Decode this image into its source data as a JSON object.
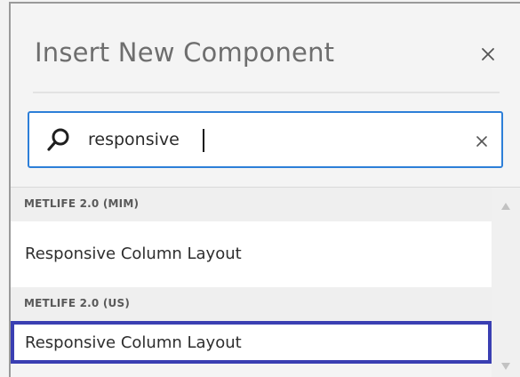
{
  "dialog": {
    "title": "Insert New Component",
    "close_icon": "close-icon"
  },
  "search": {
    "value": "responsive",
    "placeholder": "",
    "search_icon": "search-icon",
    "clear_icon": "clear-icon"
  },
  "groups": [
    {
      "name": "METLIFE 2.0 (MIM)",
      "items": [
        {
          "label": "Responsive Column Layout"
        }
      ]
    },
    {
      "name": "METLIFE 2.0 (US)",
      "items": [
        {
          "label": "Responsive Column Layout"
        }
      ]
    }
  ],
  "colors": {
    "focus_border": "#2d7fd8",
    "selected_border": "#3a3fb2"
  }
}
